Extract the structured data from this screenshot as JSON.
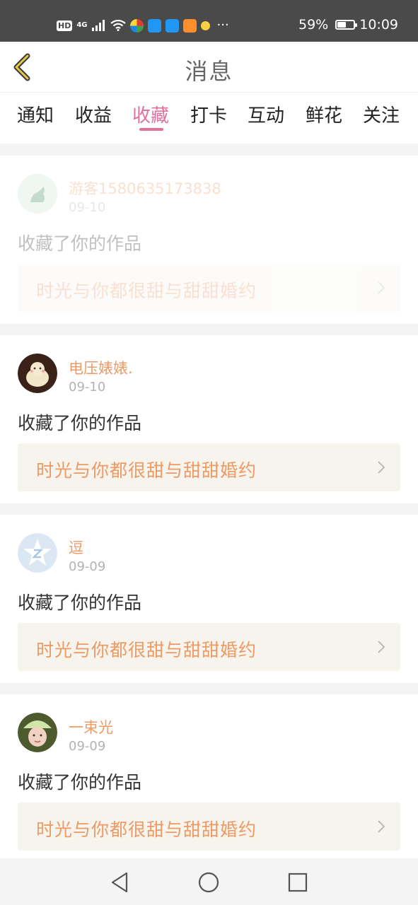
{
  "status_bar": {
    "hd": "HD",
    "network": "4G",
    "more": "···",
    "battery": "59%",
    "battery_level": 0.59,
    "time": "10:09",
    "icons": [
      "signal-icon",
      "wifi-icon",
      "app-icon",
      "app-icon",
      "app-icon",
      "app-icon",
      "app-icon"
    ]
  },
  "header": {
    "title": "消息",
    "back_icon": "chevron-left-icon"
  },
  "tabs": [
    {
      "label": "通知",
      "active": false
    },
    {
      "label": "收益",
      "active": false
    },
    {
      "label": "收藏",
      "active": true
    },
    {
      "label": "打卡",
      "active": false
    },
    {
      "label": "互动",
      "active": false
    },
    {
      "label": "鲜花",
      "active": false
    },
    {
      "label": "关注",
      "active": false
    }
  ],
  "items": [
    {
      "username": "游客1580635173838",
      "date": "09-10",
      "action": "收藏了你的作品",
      "work_title": "时光与你都很甜与甜甜婚约"
    },
    {
      "username": "电压婊婊.",
      "date": "09-10",
      "action": "收藏了你的作品",
      "work_title": "时光与你都很甜与甜甜婚约"
    },
    {
      "username": "逗",
      "date": "09-09",
      "action": "收藏了你的作品",
      "work_title": "时光与你都很甜与甜甜婚约"
    },
    {
      "username": "一束光",
      "date": "09-09",
      "action": "收藏了你的作品",
      "work_title": "时光与你都很甜与甜甜婚约"
    }
  ],
  "colors": {
    "accent": "#e070a0",
    "username": "#ec9a66",
    "work_bg": "#f6f4ec"
  },
  "nav_bar": {
    "back": "nav-back-icon",
    "home": "nav-home-icon",
    "recents": "nav-recents-icon"
  }
}
